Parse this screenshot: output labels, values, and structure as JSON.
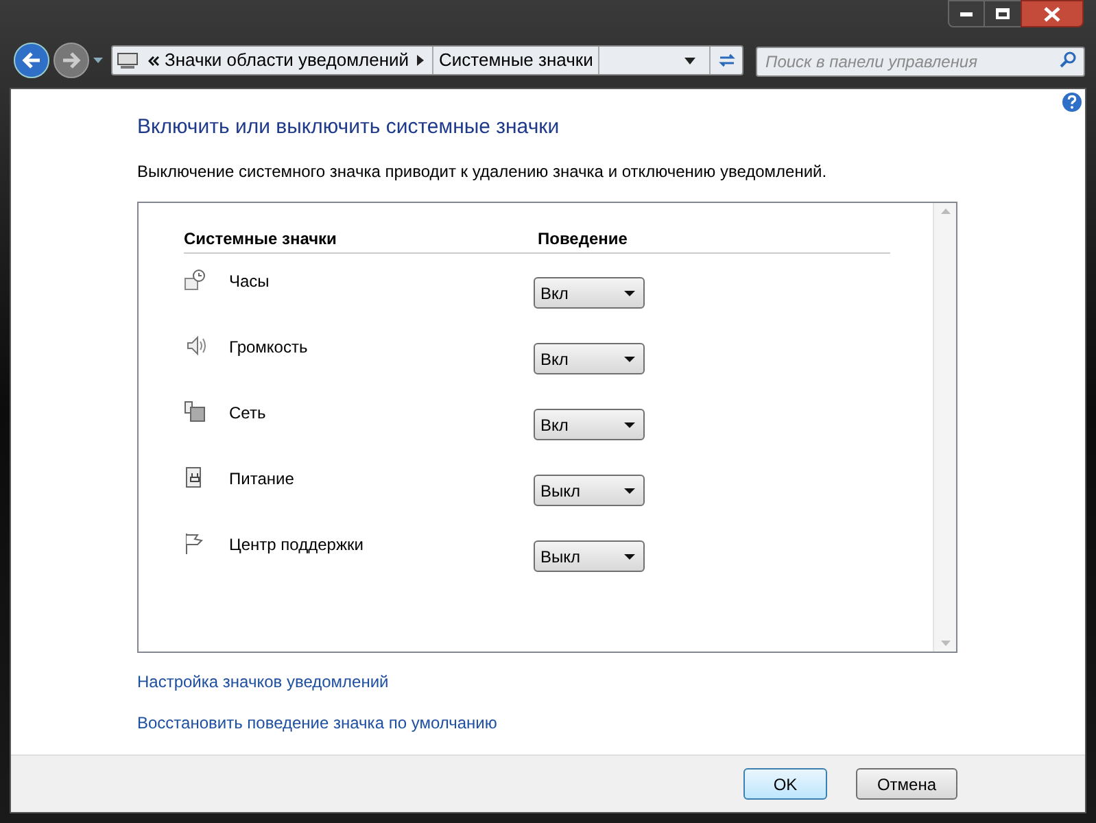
{
  "address_bar": {
    "breadcrumbs": [
      "Значки области уведомлений",
      "Системные значки"
    ]
  },
  "search": {
    "placeholder": "Поиск в панели управления"
  },
  "heading": "Включить или выключить системные значки",
  "description": "Выключение системного значка приводит к удалению значка и отключению уведомлений.",
  "table": {
    "columns": [
      "Системные значки",
      "Поведение"
    ],
    "rows": [
      {
        "kind": "clock",
        "name": "Часы",
        "behavior": "Вкл"
      },
      {
        "kind": "volume",
        "name": "Громкость",
        "behavior": "Вкл"
      },
      {
        "kind": "network",
        "name": "Сеть",
        "behavior": "Вкл"
      },
      {
        "kind": "power",
        "name": "Питание",
        "behavior": "Выкл"
      },
      {
        "kind": "flag",
        "name": "Центр поддержки",
        "behavior": "Выкл"
      }
    ]
  },
  "links": [
    "Настройка значков уведомлений",
    "Восстановить поведение значка по умолчанию"
  ],
  "buttons": [
    "OK",
    "Отмена"
  ]
}
